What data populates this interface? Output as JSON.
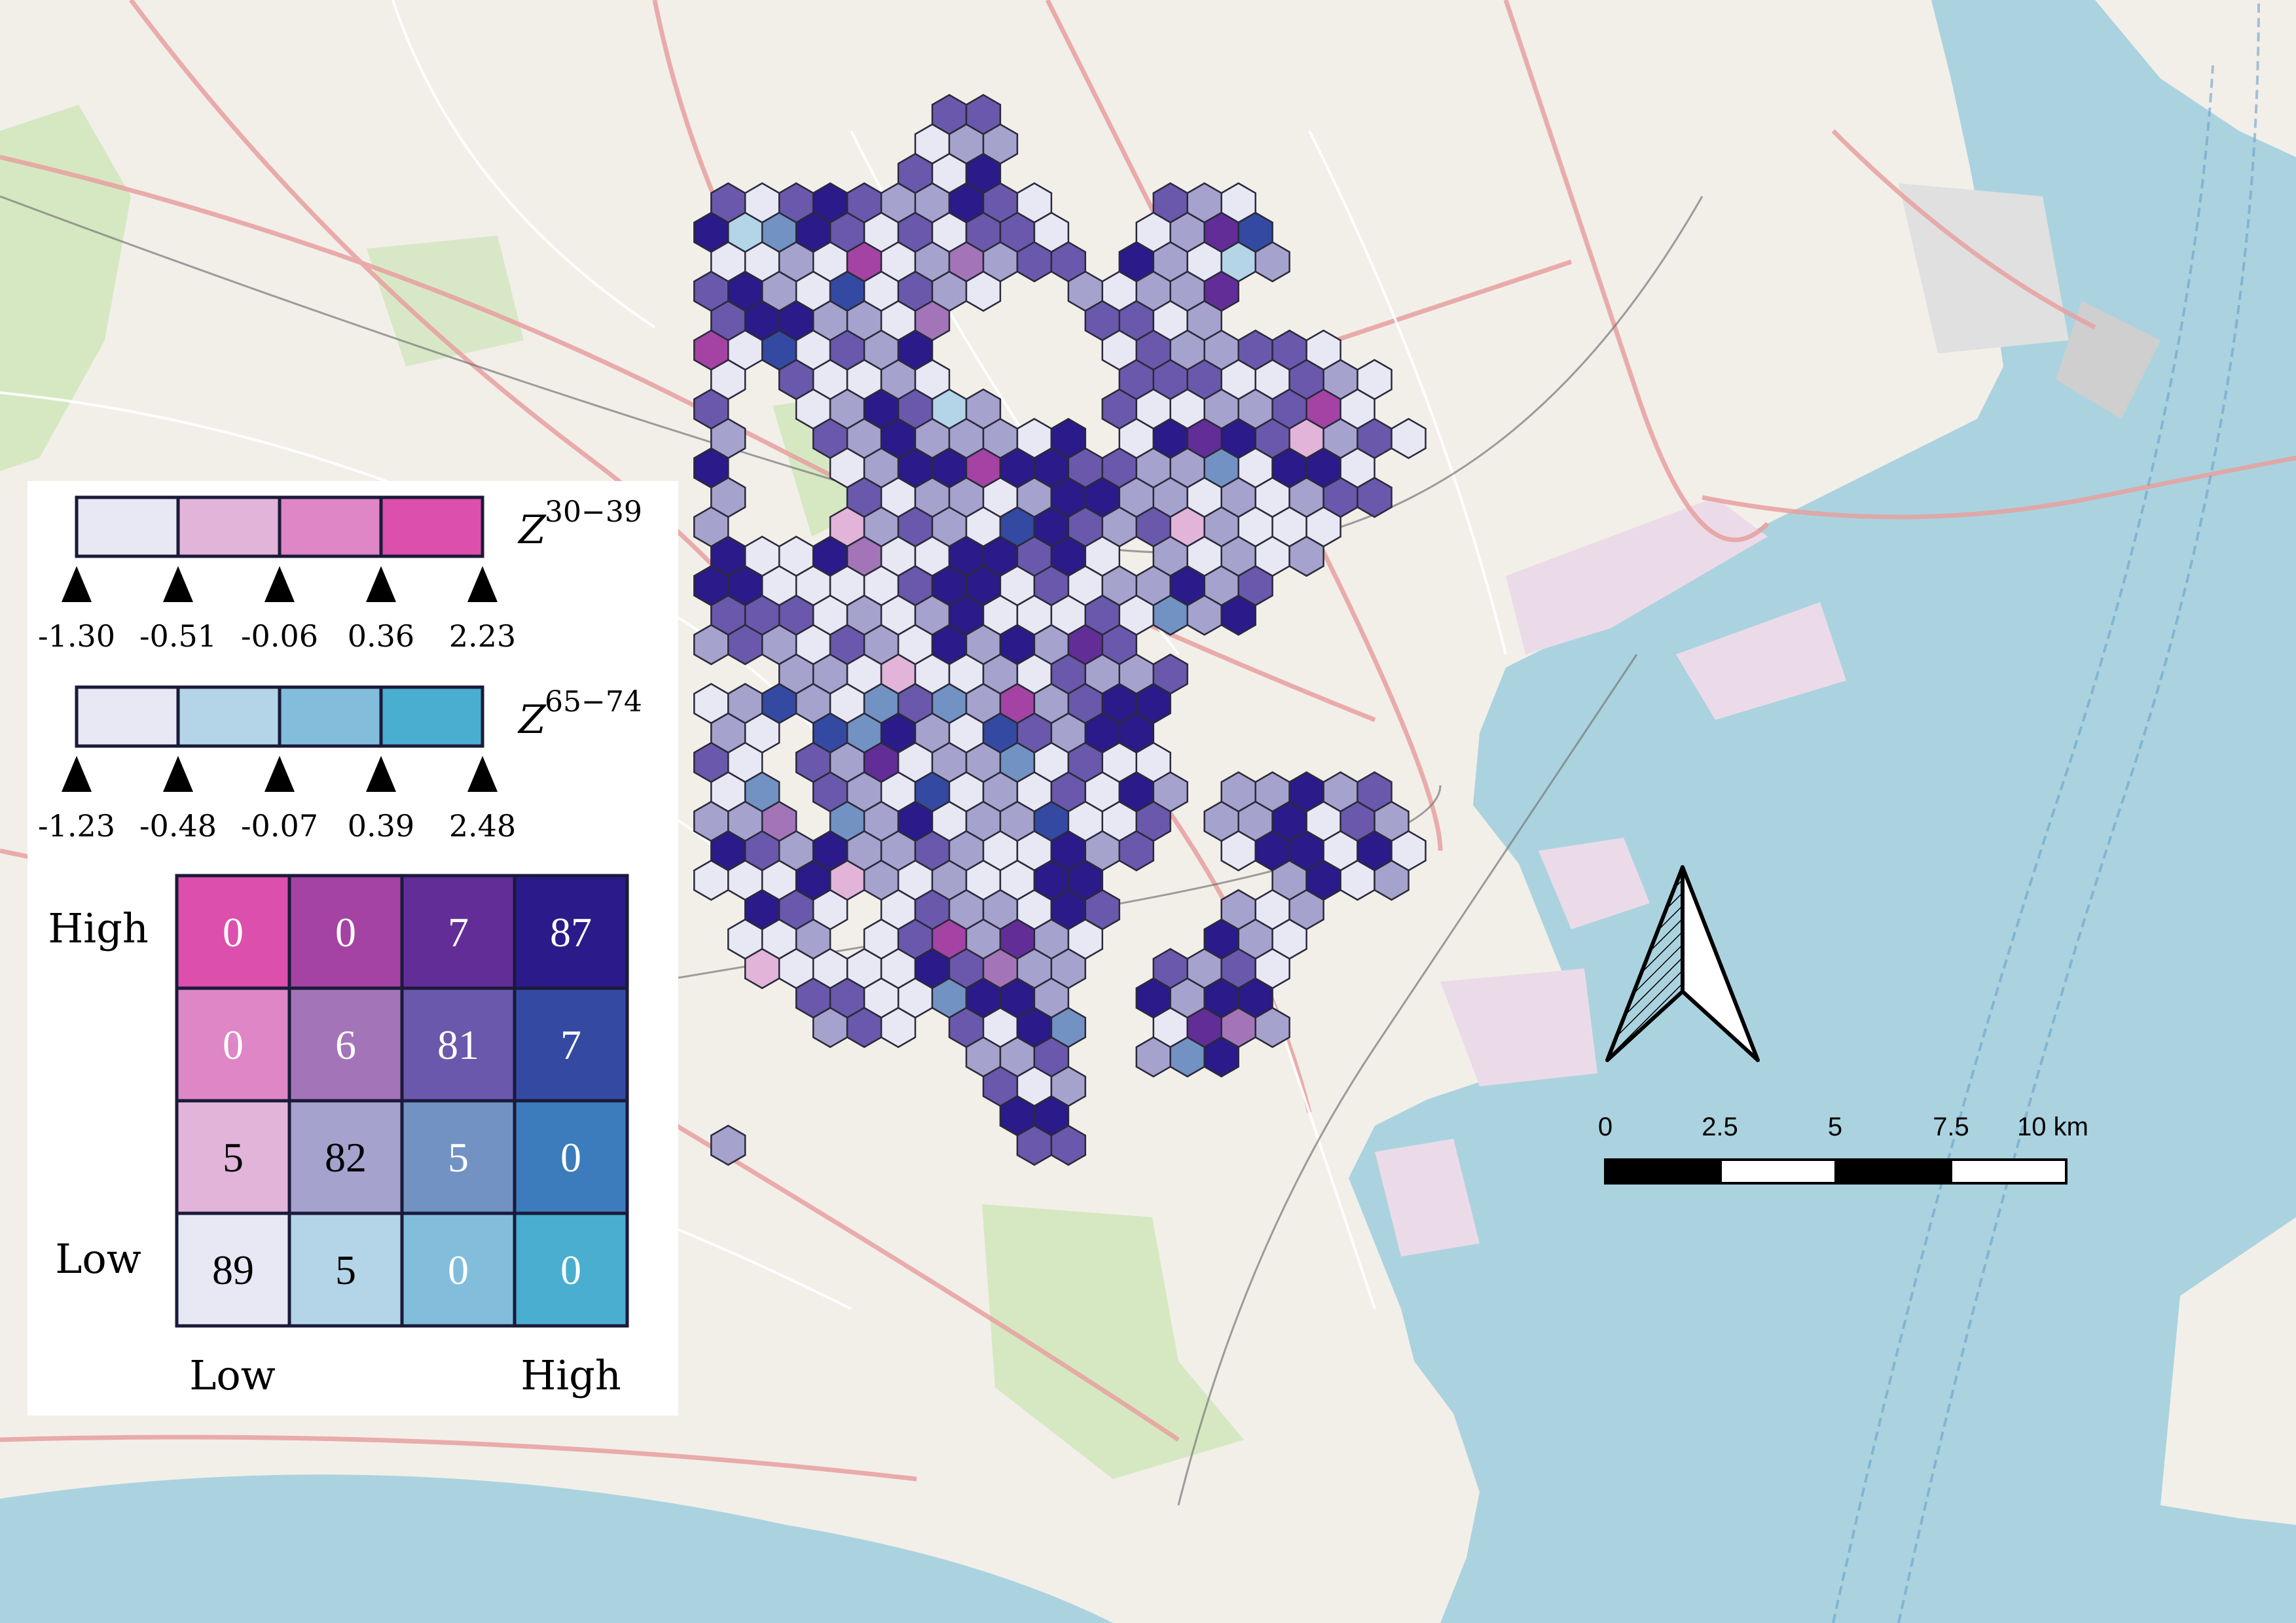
{
  "colors": {
    "sea": "#aad3df",
    "land": "#f2efe9",
    "green": "#cde6b8",
    "industrial": "#ebdbe8",
    "road_major": "#e8a0a0",
    "road_minor": "#ffffff",
    "rail": "#777777",
    "hex_border": "#2a2a3a"
  },
  "legend": {
    "z3039": {
      "symbol": "Z",
      "superscript": "30−39",
      "breaks": [
        "-1.30",
        "-0.51",
        "-0.06",
        "0.36",
        "2.23"
      ],
      "colors": [
        "#e8e8f4",
        "#e2b4d9",
        "#de86c6",
        "#dd4fac"
      ]
    },
    "z6574": {
      "symbol": "Z",
      "superscript": "65−74",
      "breaks": [
        "-1.23",
        "-0.48",
        "-0.07",
        "0.39",
        "2.48"
      ],
      "colors": [
        "#e8e8f4",
        "#b4d4e8",
        "#82bedb",
        "#4aaed0"
      ]
    },
    "matrix": {
      "y_high": "High",
      "y_low": "Low",
      "x_low": "Low",
      "x_high": "High",
      "rows": [
        {
          "values": [
            "0",
            "0",
            "7",
            "87"
          ],
          "colors": [
            "#dd4fac",
            "#a443a4",
            "#632d98",
            "#2a1a8a"
          ]
        },
        {
          "values": [
            "0",
            "6",
            "81",
            "7"
          ],
          "colors": [
            "#de86c6",
            "#a474b8",
            "#6a58ac",
            "#344aa2"
          ]
        },
        {
          "values": [
            "5",
            "82",
            "5",
            "0"
          ],
          "colors": [
            "#e2b4d9",
            "#a6a2ce",
            "#7292c4",
            "#3c7cbc"
          ]
        },
        {
          "values": [
            "89",
            "5",
            "0",
            "0"
          ],
          "colors": [
            "#e8e8f4",
            "#b4d4e8",
            "#82bedb",
            "#4aaed0"
          ]
        }
      ]
    }
  },
  "scalebar": {
    "labels": [
      "0",
      "2.5",
      "5",
      "7.5",
      "10 km"
    ]
  },
  "hex_map": {
    "palette": [
      "#e8e8f4",
      "#a6a2ce",
      "#6a58ac",
      "#2a1a8a",
      "#e2b4d9",
      "#a474b8",
      "#b4d4e8",
      "#344aa2",
      "#7292c4",
      "#632d98",
      "#a443a4"
    ]
  }
}
